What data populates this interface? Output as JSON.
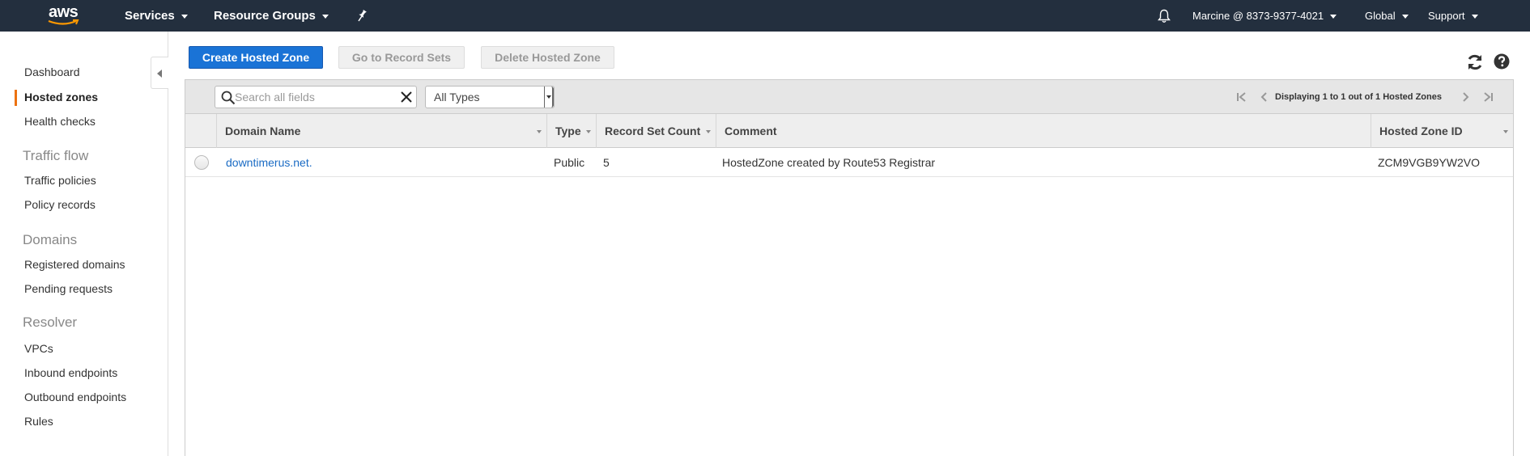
{
  "topnav": {
    "logo_text": "aws",
    "services": "Services",
    "resource_groups": "Resource Groups",
    "pin_icon": "pin-icon",
    "bell_icon": "bell-icon",
    "account": "Marcine @ 8373-9377-4021",
    "region": "Global",
    "support": "Support"
  },
  "sidebar": {
    "items": [
      {
        "label": "Dashboard"
      },
      {
        "label": "Hosted zones",
        "active": true
      },
      {
        "label": "Health checks"
      }
    ],
    "traffic_flow": {
      "heading": "Traffic flow",
      "items": [
        {
          "label": "Traffic policies"
        },
        {
          "label": "Policy records"
        }
      ]
    },
    "domains": {
      "heading": "Domains",
      "items": [
        {
          "label": "Registered domains"
        },
        {
          "label": "Pending requests"
        }
      ]
    },
    "resolver": {
      "heading": "Resolver",
      "items": [
        {
          "label": "VPCs"
        },
        {
          "label": "Inbound endpoints"
        },
        {
          "label": "Outbound endpoints"
        },
        {
          "label": "Rules"
        }
      ]
    },
    "accent_color": "#ec7211"
  },
  "toolbar": {
    "create": "Create Hosted Zone",
    "go_to_record_sets": "Go to Record Sets",
    "delete": "Delete Hosted Zone"
  },
  "filter": {
    "search_placeholder": "Search all fields",
    "search_value": "",
    "type_selected": "All Types",
    "pager_text": "Displaying 1 to 1 out of 1 Hosted Zones"
  },
  "table": {
    "columns": [
      "Domain Name",
      "Type",
      "Record Set Count",
      "Comment",
      "Hosted Zone ID"
    ],
    "rows": [
      {
        "domain": "downtimerus.net.",
        "type": "Public",
        "record_count": "5",
        "comment": "HostedZone created by Route53 Registrar",
        "zone_id": "ZCM9VGB9YW2VO"
      }
    ]
  },
  "colors": {
    "nav_bg": "#232f3e",
    "primary_button": "#1a73d6",
    "link": "#1a6bc4"
  }
}
